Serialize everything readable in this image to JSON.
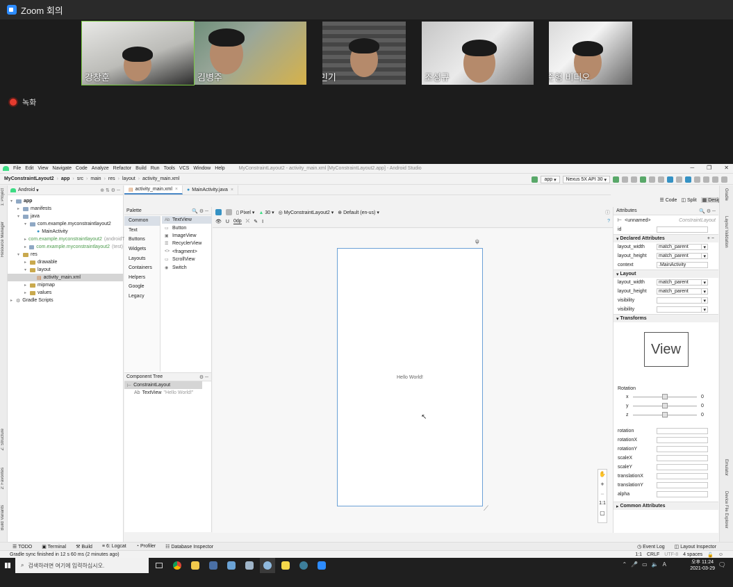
{
  "zoom": {
    "title": "Zoom 회의",
    "recording_label": "녹화",
    "participants": [
      {
        "name": "강창훈",
        "active": true
      },
      {
        "name": "김병주",
        "active": false
      },
      {
        "name": "박민기",
        "active": false
      },
      {
        "name": "조성규",
        "active": false
      },
      {
        "name": "박준형 비디오",
        "active": false
      }
    ]
  },
  "studio": {
    "menu": [
      "File",
      "Edit",
      "View",
      "Navigate",
      "Code",
      "Analyze",
      "Refactor",
      "Build",
      "Run",
      "Tools",
      "VCS",
      "Window",
      "Help"
    ],
    "window_title": "MyConstraintLayout2 - activity_main.xml [MyConstraintLayout2.app] - Android Studio",
    "breadcrumbs": [
      "MyConstraintLayout2",
      "app",
      "src",
      "main",
      "res",
      "layout",
      "activity_main.xml"
    ],
    "run_config": "app",
    "device": "Nexus 5X API 30",
    "project_view": "Android",
    "tree": [
      {
        "label": "app",
        "depth": 0,
        "type": "folder",
        "bold": true
      },
      {
        "label": "manifests",
        "depth": 1,
        "type": "folder"
      },
      {
        "label": "java",
        "depth": 1,
        "type": "folder"
      },
      {
        "label": "com.example.myconstraintlayout2",
        "depth": 2,
        "type": "folder"
      },
      {
        "label": "MainActivity",
        "depth": 3,
        "type": "class"
      },
      {
        "label": "com.example.myconstraintlayout2",
        "suffix": "(androidTest)",
        "depth": 2,
        "type": "folder",
        "green": true
      },
      {
        "label": "com.example.myconstraintlayout2",
        "suffix": "(test)",
        "depth": 2,
        "type": "folder",
        "green": true
      },
      {
        "label": "res",
        "depth": 1,
        "type": "res"
      },
      {
        "label": "drawable",
        "depth": 2,
        "type": "res"
      },
      {
        "label": "layout",
        "depth": 2,
        "type": "res"
      },
      {
        "label": "activity_main.xml",
        "depth": 3,
        "type": "xml",
        "selected": true
      },
      {
        "label": "mipmap",
        "depth": 2,
        "type": "res"
      },
      {
        "label": "values",
        "depth": 2,
        "type": "res"
      },
      {
        "label": "Gradle Scripts",
        "depth": 0,
        "type": "gradle"
      }
    ],
    "editor_tabs": [
      {
        "label": "activity_main.xml",
        "active": true
      },
      {
        "label": "MainActivity.java",
        "active": false
      }
    ],
    "view_modes": [
      "Code",
      "Split",
      "Design"
    ],
    "palette": {
      "title": "Palette",
      "categories": [
        "Common",
        "Text",
        "Buttons",
        "Widgets",
        "Layouts",
        "Containers",
        "Helpers",
        "Google",
        "Legacy"
      ],
      "items": [
        {
          "icon": "Ab",
          "label": "TextView"
        },
        {
          "icon": "▭",
          "label": "Button"
        },
        {
          "icon": "▣",
          "label": "ImageView"
        },
        {
          "icon": "☰",
          "label": "RecyclerView"
        },
        {
          "icon": "<>",
          "label": "<fragment>"
        },
        {
          "icon": "▭",
          "label": "ScrollView"
        },
        {
          "icon": "◉",
          "label": "Switch"
        }
      ]
    },
    "component_tree": {
      "title": "Component Tree",
      "root": "ConstraintLayout",
      "child_label": "TextView",
      "child_value": "\"Hello World!\""
    },
    "design_toolbar": {
      "device": "Pixel",
      "api": "30",
      "theme": "MyConstraintLayout2",
      "locale": "Default (en-us)",
      "margin": "0dp"
    },
    "canvas_text": "Hello World!",
    "attributes": {
      "title": "Attributes",
      "component": "<unnamed>",
      "component_type": "ConstraintLayout",
      "id_label": "id",
      "declared_title": "Declared Attributes",
      "declared": [
        {
          "k": "layout_width",
          "v": "match_parent"
        },
        {
          "k": "layout_height",
          "v": "match_parent"
        },
        {
          "k": "context",
          "v": ".MainActivity"
        }
      ],
      "layout_title": "Layout",
      "layout": [
        {
          "k": "layout_width",
          "v": "match_parent"
        },
        {
          "k": "layout_height",
          "v": "match_parent"
        },
        {
          "k": "visibility",
          "v": ""
        },
        {
          "k": "visibility",
          "v": ""
        }
      ],
      "transforms_title": "Transforms",
      "view_label": "View",
      "rotation_label": "Rotation",
      "rotation_axes": [
        {
          "k": "x",
          "v": "0"
        },
        {
          "k": "y",
          "v": "0"
        },
        {
          "k": "z",
          "v": "0"
        }
      ],
      "transform_fields": [
        "rotation",
        "rotationX",
        "rotationY",
        "scaleX",
        "scaleY",
        "translationX",
        "translationY",
        "alpha"
      ],
      "common_title": "Common Attributes"
    },
    "bottom_tabs": [
      "TODO",
      "Terminal",
      "Build",
      "6: Logcat",
      "Profiler",
      "Database Inspector"
    ],
    "bottom_right_tabs": [
      "Event Log",
      "Layout Inspector"
    ],
    "status_text": "Gradle sync finished in 12 s 60 ms (2 minutes ago)",
    "status_right": [
      "1:1",
      "CRLF",
      "UTF-8",
      "4 spaces"
    ],
    "left_strip": [
      "1: Project",
      "Resource Manager",
      "Z: Structure",
      "2: Favorites",
      "Build Variants"
    ],
    "right_strip": [
      "Gradle",
      "Layout Validation",
      "Emulator",
      "Device File Explorer"
    ]
  },
  "taskbar": {
    "search_placeholder": "검색하려면 여기에 입력하십시오.",
    "time": "오후 11:24",
    "date": "2021-03-29",
    "ime": "A"
  }
}
